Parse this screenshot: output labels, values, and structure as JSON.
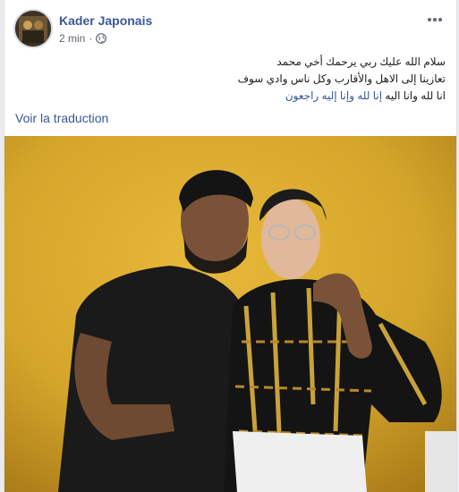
{
  "post": {
    "author": "Kader Japonais",
    "time": "2 min",
    "separator": "·",
    "privacy_icon": "globe-icon",
    "more_icon": "more-options-icon",
    "lines": [
      {
        "text": "سلام الله عليك ربي يرحمك أخي محمد"
      },
      {
        "text": "تعازينا إلى الاهل والأقارب وكل ناس وادي سوف"
      },
      {
        "pre": "انا لله وانا اليه ",
        "highlight": "إنا لله وإنا إليه راجعون"
      }
    ],
    "translate_link": "Voir la traduction"
  },
  "colors": {
    "link": "#385898",
    "meta": "#606770",
    "text": "#1c1e21",
    "photo_background": "#d4a52a"
  }
}
